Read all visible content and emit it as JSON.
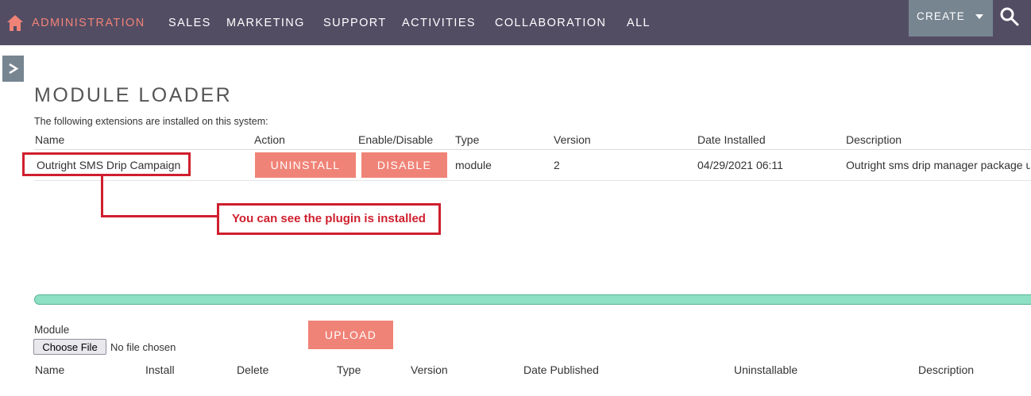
{
  "nav": {
    "items": [
      {
        "label": "ADMINISTRATION"
      },
      {
        "label": "SALES"
      },
      {
        "label": "MARKETING"
      },
      {
        "label": "SUPPORT"
      },
      {
        "label": "ACTIVITIES"
      },
      {
        "label": "COLLABORATION"
      },
      {
        "label": "ALL"
      }
    ],
    "create_label": "CREATE"
  },
  "page": {
    "title": "MODULE LOADER",
    "intro": "The following extensions are installed on this system:"
  },
  "installed": {
    "headers": [
      "Name",
      "Action",
      "Enable/Disable",
      "Type",
      "Version",
      "Date Installed",
      "Description"
    ],
    "rows": [
      {
        "name": "Outright SMS Drip Campaign",
        "action": "UNINSTALL",
        "toggle": "DISABLE",
        "type": "module",
        "version": "2",
        "date": "04/29/2021 06:11",
        "description": "Outright sms drip manager package u"
      }
    ]
  },
  "annotation": {
    "text": "You can see the plugin is installed"
  },
  "upload": {
    "module_label": "Module",
    "file_button": "Choose File",
    "file_status": "No file chosen",
    "upload_label": "UPLOAD"
  },
  "packages": {
    "headers": [
      "Name",
      "Install",
      "Delete",
      "Type",
      "Version",
      "Date Published",
      "Uninstallable",
      "Description"
    ]
  },
  "colors": {
    "nav_bg": "#534d64",
    "accent": "#f08377",
    "annotation": "#cf1f2e",
    "progress": "#8ee0c4"
  }
}
